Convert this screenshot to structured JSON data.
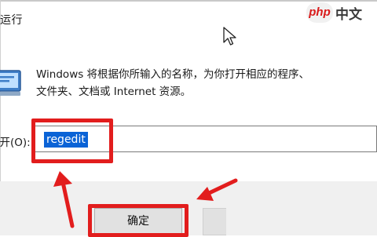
{
  "window": {
    "title": "运行",
    "description_line1": "Windows 将根据你所输入的名称，为你打开相应的程序、",
    "description_line2": "文件夹、文档或 Internet 资源。",
    "open_label": "打开(O):",
    "input_value": "regedit",
    "ok_button": "确定"
  },
  "watermark": {
    "badge": "php",
    "text": "中文"
  },
  "annotations": {
    "highlight_color": "#e21d1d",
    "selection_color": "#0a63d6"
  },
  "icons": [
    "cursor-arrow-icon",
    "run-program-icon"
  ]
}
